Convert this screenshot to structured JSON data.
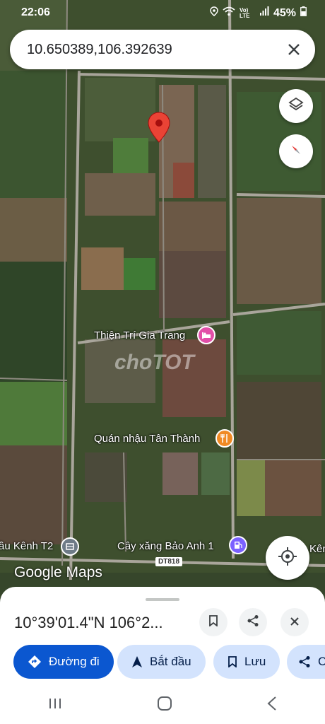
{
  "status_bar": {
    "time": "22:06",
    "network": "Vo) LTE",
    "battery": "45%"
  },
  "search": {
    "query": "10.650389,106.392639",
    "clear_icon": "close-icon"
  },
  "map": {
    "places": {
      "hotel": "Thiện Trí Gia Trang",
      "restaurant": "Quán nhậu Tân Thành",
      "gas_station": "Cây xăng Bảo Anh 1",
      "left_edge": "ầu Kênh T2",
      "right_edge": "Kên"
    },
    "road_tag": "DT818",
    "watermark": "choTOT",
    "logo": "Google Maps"
  },
  "sheet": {
    "coordinates": "10°39'01.4\"N 106°2...",
    "actions": {
      "directions": "Đường đi",
      "start": "Bắt đầu",
      "save": "Lưu",
      "share_partial": "C"
    }
  },
  "colors": {
    "primary": "#0b57d0",
    "secondary": "#d3e3fd",
    "pin": "#ea4335"
  }
}
